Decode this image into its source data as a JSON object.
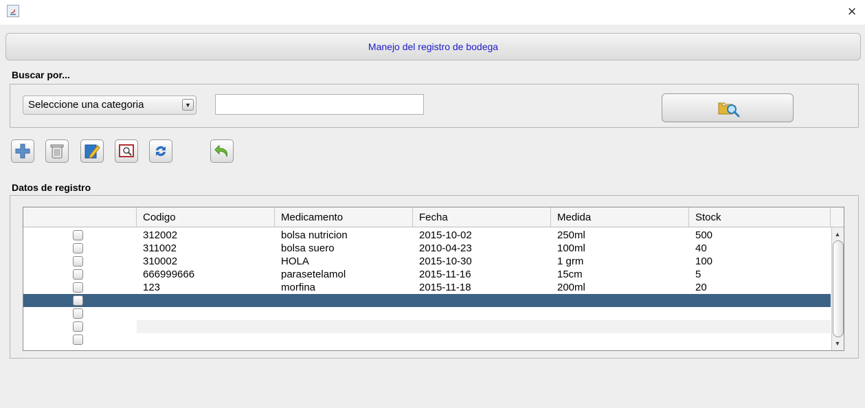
{
  "window": {
    "close_glyph": "×"
  },
  "header": {
    "title": "Manejo del registro de bodega"
  },
  "search": {
    "section_label": "Buscar por...",
    "category_selected": "Seleccione una categoria",
    "query_value": "",
    "button_icon": "search-folder-icon"
  },
  "toolbar": {
    "buttons": [
      {
        "icon": "add-icon"
      },
      {
        "icon": "delete-icon"
      },
      {
        "icon": "edit-icon"
      },
      {
        "icon": "view-icon"
      },
      {
        "icon": "refresh-icon"
      },
      {
        "icon": "undo-icon"
      }
    ]
  },
  "data": {
    "section_label": "Datos de registro",
    "columns": [
      "",
      "Codigo",
      "Medicamento",
      "Fecha",
      "Medida",
      "Stock"
    ],
    "rows": [
      {
        "codigo": "312002",
        "medicamento": "bolsa nutricion",
        "fecha": "2015-10-02",
        "medida": "250ml",
        "stock": "500"
      },
      {
        "codigo": "311002",
        "medicamento": "bolsa suero",
        "fecha": "2010-04-23",
        "medida": "100ml",
        "stock": "40"
      },
      {
        "codigo": "310002",
        "medicamento": "HOLA",
        "fecha": "2015-10-30",
        "medida": "1 grm",
        "stock": "100"
      },
      {
        "codigo": "666999666",
        "medicamento": "parasetelamol",
        "fecha": "2015-11-16",
        "medida": "15cm",
        "stock": "5"
      },
      {
        "codigo": "123",
        "medicamento": "morfina",
        "fecha": "2015-11-18",
        "medida": "200ml",
        "stock": "20"
      },
      {
        "codigo": "",
        "medicamento": "",
        "fecha": "",
        "medida": "",
        "stock": ""
      },
      {
        "codigo": "",
        "medicamento": "",
        "fecha": "",
        "medida": "",
        "stock": ""
      },
      {
        "codigo": "",
        "medicamento": "",
        "fecha": "",
        "medida": "",
        "stock": ""
      },
      {
        "codigo": "",
        "medicamento": "",
        "fecha": "",
        "medida": "",
        "stock": ""
      }
    ],
    "selected_row": 5
  },
  "colors": {
    "selection": "#3c6286",
    "title_text": "#1c1cc8",
    "stripe": "#f2f2f2"
  }
}
